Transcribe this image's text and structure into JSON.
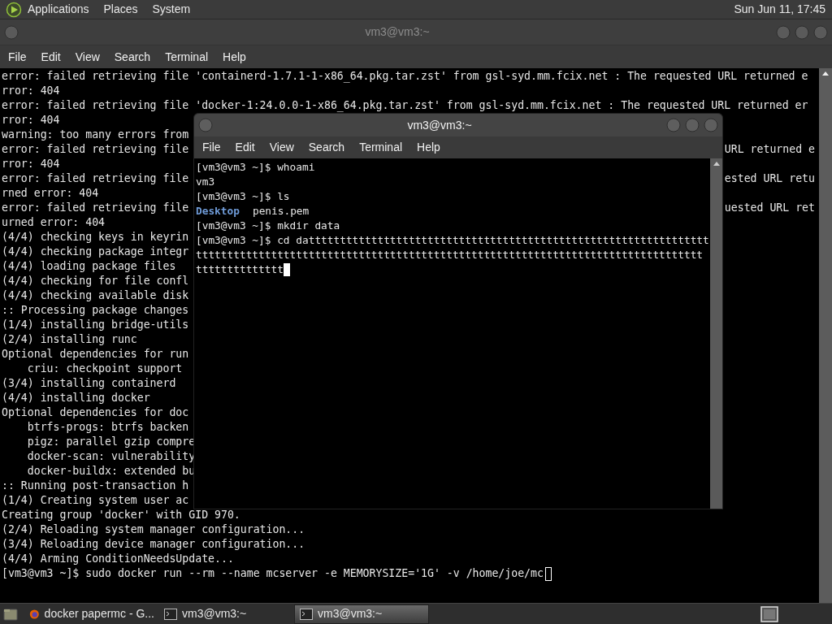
{
  "top_panel": {
    "menus": [
      "Applications",
      "Places",
      "System"
    ],
    "clock": "Sun Jun 11, 17:45"
  },
  "background_terminal": {
    "title": "vm3@vm3:~",
    "active": false,
    "menu": [
      "File",
      "Edit",
      "View",
      "Search",
      "Terminal",
      "Help"
    ],
    "rows": [
      {
        "left": "error: failed retrieving file 'containerd-1.7.1-1-x86_64.pkg.tar.zst' from gsl-syd.mm.fcix.net : The requested URL returned e"
      },
      {
        "left": "rror: 404"
      },
      {
        "left": "error: failed retrieving file 'docker-1:24.0.0-1-x86_64.pkg.tar.zst' from gsl-syd.mm.fcix.net : The requested URL returned er"
      },
      {
        "left": "rror: 404"
      },
      {
        "left": "warning: too many errors from"
      },
      {
        "left": "error: failed retrieving file",
        "right": "URL returned e"
      },
      {
        "left": "rror: 404"
      },
      {
        "left": "error: failed retrieving file",
        "right": "ested URL retu"
      },
      {
        "left": "rned error: 404"
      },
      {
        "left": "error: failed retrieving file",
        "right": "uested URL ret"
      },
      {
        "left": "urned error: 404"
      },
      {
        "left": "(4/4) checking keys in keyrin"
      },
      {
        "left": "(4/4) checking package integr"
      },
      {
        "left": "(4/4) loading package files"
      },
      {
        "left": "(4/4) checking for file confl"
      },
      {
        "left": "(4/4) checking available disk"
      },
      {
        "left": ":: Processing package changes"
      },
      {
        "left": "(1/4) installing bridge-utils"
      },
      {
        "left": "(2/4) installing runc"
      },
      {
        "left": "Optional dependencies for run"
      },
      {
        "left": "    criu: checkpoint support"
      },
      {
        "left": "(3/4) installing containerd"
      },
      {
        "left": "(4/4) installing docker"
      },
      {
        "left": "Optional dependencies for doc"
      },
      {
        "left": "    btrfs-progs: btrfs backen"
      },
      {
        "left": "    pigz: parallel gzip compre"
      },
      {
        "left": "    docker-scan: vulnerability"
      },
      {
        "left": "    docker-buildx: extended bu"
      },
      {
        "left": ":: Running post-transaction h"
      },
      {
        "left": "(1/4) Creating system user ac"
      },
      {
        "left": "Creating group 'docker' with GID 970."
      },
      {
        "left": "(2/4) Reloading system manager configuration..."
      },
      {
        "left": "(3/4) Reloading device manager configuration..."
      },
      {
        "left": "(4/4) Arming ConditionNeedsUpdate..."
      },
      {
        "left": "[vm3@vm3 ~]$ sudo docker run --rm --name mcserver -e MEMORYSIZE='1G' -v /home/joe/mc",
        "cursor": true
      }
    ]
  },
  "front_terminal": {
    "title": "vm3@vm3:~",
    "active": true,
    "menu": [
      "File",
      "Edit",
      "View",
      "Search",
      "Terminal",
      "Help"
    ],
    "lines": [
      {
        "kind": "text",
        "text": "[vm3@vm3 ~]$ whoami"
      },
      {
        "kind": "text",
        "text": "vm3"
      },
      {
        "kind": "text",
        "text": "[vm3@vm3 ~]$ ls"
      },
      {
        "kind": "listing",
        "entries": [
          {
            "name": "Desktop",
            "kind": "directory"
          },
          {
            "name": "penis.pem",
            "kind": "file"
          }
        ]
      },
      {
        "kind": "text",
        "text": "[vm3@vm3 ~]$ mkdir data"
      },
      {
        "kind": "text",
        "text": "[vm3@vm3 ~]$ cd datttttttttttttttttttttttttttttttttttttttttttttttttttttttttttttttt"
      },
      {
        "kind": "text",
        "text": "ttttttttttttttttttttttttttttttttttttttttttttttttttttttttttttttttttttttttttttttttt"
      },
      {
        "kind": "text",
        "text": "tttttttttttttt",
        "cursor": true
      }
    ]
  },
  "taskbar": {
    "items": [
      {
        "kind": "browser",
        "label": "docker papermc - G...",
        "selected": false
      },
      {
        "kind": "terminal",
        "label": "vm3@vm3:~",
        "selected": false
      },
      {
        "kind": "terminal",
        "label": "vm3@vm3:~",
        "selected": true
      }
    ]
  }
}
